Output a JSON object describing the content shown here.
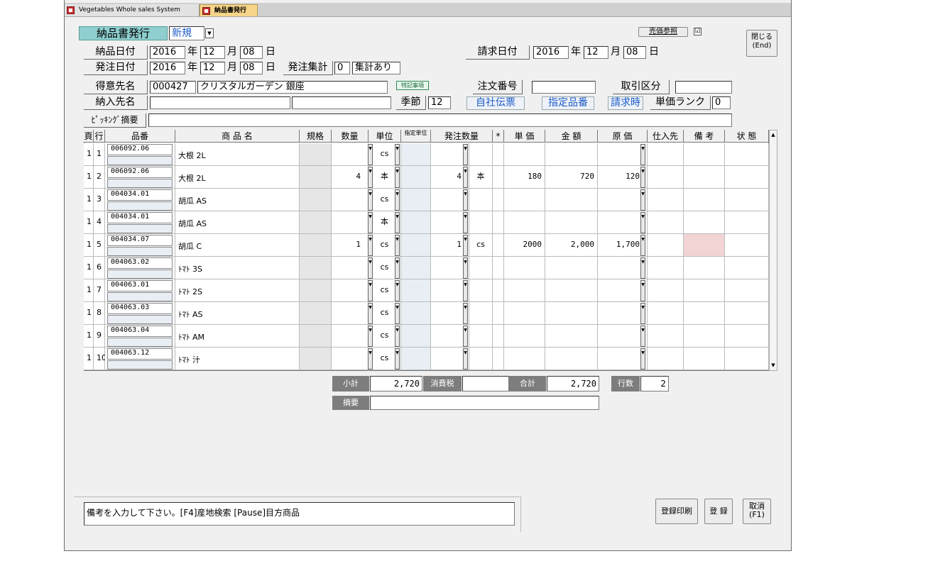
{
  "tabs": [
    {
      "label": "Vegetables Whole sales System"
    },
    {
      "label": "納品書発行"
    }
  ],
  "form": {
    "title": "納品書発行",
    "mode": "新規",
    "delivery_date_label": "納品日付",
    "delivery_date": {
      "year": "2016",
      "month": "12",
      "day": "08"
    },
    "order_date_label": "発注日付",
    "order_date": {
      "year": "2016",
      "month": "12",
      "day": "08"
    },
    "unit_year": "年",
    "unit_month": "月",
    "unit_day": "日",
    "order_total_label": "発注集計",
    "order_total_value": "0",
    "order_total_status": "集計あり",
    "invoice_date_label": "請求日付",
    "invoice_date": {
      "year": "2016",
      "month": "12",
      "day": "08"
    },
    "customer_label": "得意先名",
    "customer_code": "000427",
    "customer_name": "クリスタルガーデン 銀座",
    "special_label": "特記事項",
    "delivery_dest_label": "納入先名",
    "season_label": "季節",
    "season_value": "12",
    "order_no_label": "注文番号",
    "trade_type_label": "取引区分",
    "own_slip": "自社伝票",
    "spec_item": "指定品番",
    "invoice_time": "請求時",
    "price_rank_label": "単価ランク",
    "price_rank_value": "0",
    "picking_label": "ﾋﾟｯｷﾝｸﾞ摘要",
    "sales_ref_label": "売価参照",
    "sales_ref_checked": "☑",
    "close_label": "閉じる",
    "close_key": "(End)"
  },
  "grid": {
    "headers": [
      "頁",
      "行",
      "品番",
      "商 品 名",
      "規格",
      "数量",
      "単位",
      "指定単位",
      "発注数量",
      "*",
      "単 価",
      "金 額",
      "原 価",
      "仕入先",
      "備 考",
      "状 態"
    ],
    "rows": [
      {
        "page": "1",
        "line": "1",
        "code": "006092.06",
        "name": "大根 2L",
        "qty": "",
        "unit": "cs",
        "oqty": "",
        "ounit": "",
        "price": "",
        "amount": "",
        "cost": ""
      },
      {
        "page": "1",
        "line": "2",
        "code": "006092.06",
        "name": "大根 2L",
        "qty": "4",
        "unit": "本",
        "oqty": "4",
        "ounit": "本",
        "price": "180",
        "amount": "720",
        "cost": "120"
      },
      {
        "page": "1",
        "line": "3",
        "code": "004034.01",
        "name": "胡瓜 AS",
        "qty": "",
        "unit": "cs",
        "oqty": "",
        "ounit": "",
        "price": "",
        "amount": "",
        "cost": ""
      },
      {
        "page": "1",
        "line": "4",
        "code": "004034.01",
        "name": "胡瓜 AS",
        "qty": "",
        "unit": "本",
        "oqty": "",
        "ounit": "",
        "price": "",
        "amount": "",
        "cost": ""
      },
      {
        "page": "1",
        "line": "5",
        "code": "004034.07",
        "name": "胡瓜 C",
        "qty": "1",
        "unit": "cs",
        "oqty": "1",
        "ounit": "cs",
        "price": "2000",
        "amount": "2,000",
        "cost": "1,700"
      },
      {
        "page": "1",
        "line": "6",
        "code": "004063.02",
        "name": "ﾄﾏﾄ 3S",
        "qty": "",
        "unit": "cs",
        "oqty": "",
        "ounit": "",
        "price": "",
        "amount": "",
        "cost": ""
      },
      {
        "page": "1",
        "line": "7",
        "code": "004063.01",
        "name": "ﾄﾏﾄ 2S",
        "qty": "",
        "unit": "cs",
        "oqty": "",
        "ounit": "",
        "price": "",
        "amount": "",
        "cost": ""
      },
      {
        "page": "1",
        "line": "8",
        "code": "004063.03",
        "name": "ﾄﾏﾄ AS",
        "qty": "",
        "unit": "cs",
        "oqty": "",
        "ounit": "",
        "price": "",
        "amount": "",
        "cost": ""
      },
      {
        "page": "1",
        "line": "9",
        "code": "004063.04",
        "name": "ﾄﾏﾄ AM",
        "qty": "",
        "unit": "cs",
        "oqty": "",
        "ounit": "",
        "price": "",
        "amount": "",
        "cost": ""
      },
      {
        "page": "1",
        "line": "10",
        "code": "004063.12",
        "name": "ﾄﾏﾄ 汁",
        "qty": "",
        "unit": "cs",
        "oqty": "",
        "ounit": "",
        "price": "",
        "amount": "",
        "cost": ""
      }
    ]
  },
  "totals": {
    "subtotal_label": "小計",
    "subtotal": "2,720",
    "tax_label": "消費税",
    "tax": "",
    "total_label": "合計",
    "total": "2,720",
    "rows_label": "行数",
    "rows": "2",
    "memo_label": "摘要"
  },
  "status_message": "備考を入力して下さい。[F4]産地検索 [Pause]目方商品",
  "buttons": {
    "register_print": "登録印刷",
    "register": "登 録",
    "cancel": "取消",
    "cancel_key": "(F1)"
  },
  "colors": {
    "tab_active": "#f6d58a",
    "title_bg": "#8fcfcf",
    "grid_header": "#f0f0f0",
    "highlight": "#f2d4d4"
  }
}
